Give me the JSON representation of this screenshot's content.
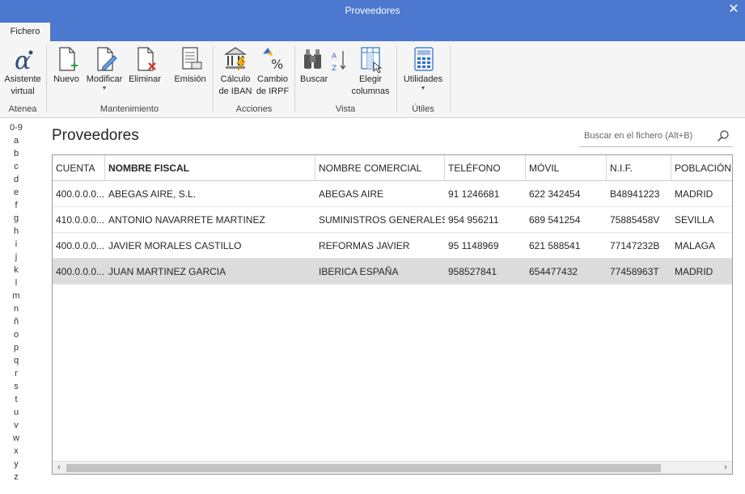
{
  "window": {
    "title": "Proveedores"
  },
  "tabs": {
    "file": "Fichero"
  },
  "ribbon": {
    "groups": [
      {
        "label": "Atenea"
      },
      {
        "label": "Mantenimiento"
      },
      {
        "label": "Acciones"
      },
      {
        "label": "Vista"
      },
      {
        "label": "Útiles"
      }
    ],
    "buttons": {
      "assistant": {
        "line1": "Asistente",
        "line2": "virtual"
      },
      "new": {
        "line1": "Nuevo"
      },
      "modify": {
        "line1": "Modificar"
      },
      "delete": {
        "line1": "Eliminar"
      },
      "issue": {
        "line1": "Emisión"
      },
      "iban": {
        "line1": "Cálculo",
        "line2": "de IBAN"
      },
      "irpf": {
        "line1": "Cambio",
        "line2": "de IRPF"
      },
      "search": {
        "line1": "Buscar"
      },
      "columns": {
        "line1": "Elegir",
        "line2": "columnas"
      },
      "utilities": {
        "line1": "Utilidades"
      }
    }
  },
  "alphabet": [
    "0-9",
    "a",
    "b",
    "c",
    "d",
    "e",
    "f",
    "g",
    "h",
    "i",
    "j",
    "k",
    "l",
    "m",
    "n",
    "ñ",
    "o",
    "p",
    "q",
    "r",
    "s",
    "t",
    "u",
    "v",
    "w",
    "x",
    "y",
    "z"
  ],
  "main": {
    "title": "Proveedores",
    "search_placeholder": "Buscar en el fichero (Alt+B)"
  },
  "table": {
    "columns": [
      "CUENTA",
      "NOMBRE FISCAL",
      "NOMBRE COMERCIAL",
      "TELÉFONO",
      "MÓVIL",
      "N.I.F.",
      "POBLACIÓN"
    ],
    "rows": [
      [
        "400.0.0.0...",
        "ABEGAS AIRE, S.L.",
        "ABEGAS AIRE",
        "91 1246681",
        "622 342454",
        "B48941223",
        "MADRID"
      ],
      [
        "410.0.0.0...",
        "ANTONIO NAVARRETE MARTINEZ",
        "SUMINISTROS GENERALES",
        "954 956211",
        "689 541254",
        "75885458V",
        "SEVILLA"
      ],
      [
        "400.0.0.0...",
        "JAVIER MORALES CASTILLO",
        "REFORMAS JAVIER",
        "95 1148969",
        "621 588541",
        "77147232B",
        "MALAGA"
      ],
      [
        "400.0.0.0...",
        "JUAN MARTINEZ GARCIA",
        "IBERICA ESPAÑA",
        "958527841",
        "654477432",
        "77458963T",
        "MADRID"
      ]
    ]
  },
  "colors": {
    "accent": "#4c78cf",
    "selected_row": "#dcdcdc"
  }
}
